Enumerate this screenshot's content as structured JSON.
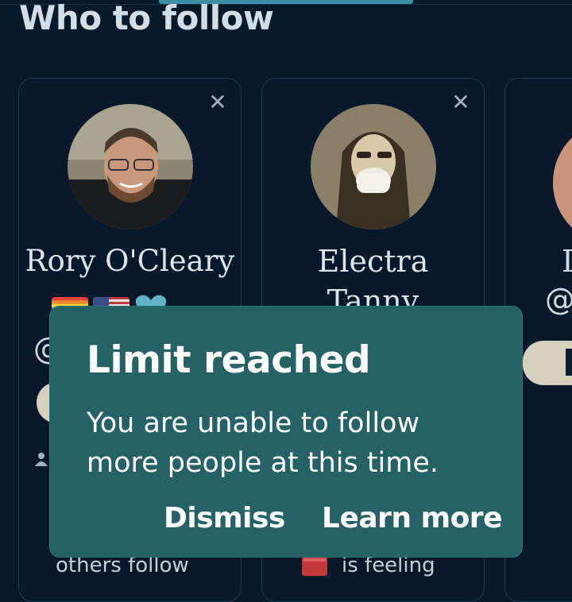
{
  "header": {
    "title": "Who to follow"
  },
  "cards": [
    {
      "name": "Rory O'Cleary",
      "handle_fragment": "@",
      "snippet": "others follow",
      "emoji": [
        "rainbow-flag-icon",
        "us-flag-icon",
        "heart-icon"
      ]
    },
    {
      "name": "Electra",
      "name_line2": "Tanny",
      "snippet": "is feeling",
      "emoji": [
        "book-icon"
      ]
    },
    {
      "name_fragment": "D",
      "handle_fragment": "@"
    }
  ],
  "toast": {
    "title": "Limit reached",
    "message": "You are unable to follow more people at this time.",
    "dismiss_label": "Dismiss",
    "learn_more_label": "Learn more"
  },
  "colors": {
    "background": "#071a2a",
    "toast": "#246266",
    "follow_pill": "#d6d0bd"
  }
}
